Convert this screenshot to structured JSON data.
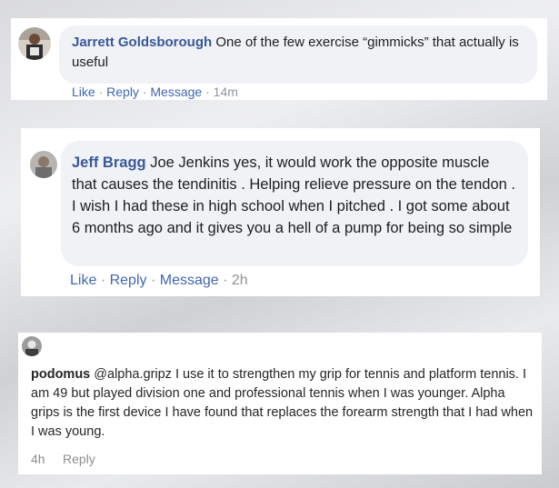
{
  "comments": [
    {
      "author": "Jarrett Goldsborough",
      "text": "One of the few exercise “gimmicks” that actually is useful",
      "actions": {
        "like": "Like",
        "reply": "Reply",
        "message": "Message",
        "time": "14m",
        "separator": "·"
      }
    },
    {
      "author": "Jeff Bragg",
      "text": "Joe Jenkins yes, it would work the opposite muscle that causes the tendinitis . Helping relieve pressure on the tendon . I wish I had these in high school when I pitched . I got some about 6 months ago and it gives you a hell of a pump for being so simple",
      "actions": {
        "like": "Like",
        "reply": "Reply",
        "message": "Message",
        "time": "2h",
        "separator": "·"
      }
    },
    {
      "author": "podomus",
      "text": "@alpha.gripz I use it to strengthen my grip for tennis and platform tennis. I am 49 but played division one and professional tennis when I was younger. Alpha grips is the first device I have found that replaces the forearm strength that I had when I was young.",
      "actions": {
        "time": "4h",
        "reply": "Reply"
      }
    }
  ],
  "colors": {
    "fb_name": "#385898",
    "fb_link": "#4267b2",
    "fb_bubble": "#f0f2f5",
    "muted": "#90949c",
    "ig_text": "#262626",
    "ig_muted": "#8e8e8e"
  },
  "icons": [
    "avatar-jarrett",
    "avatar-jeff",
    "avatar-podomus"
  ]
}
